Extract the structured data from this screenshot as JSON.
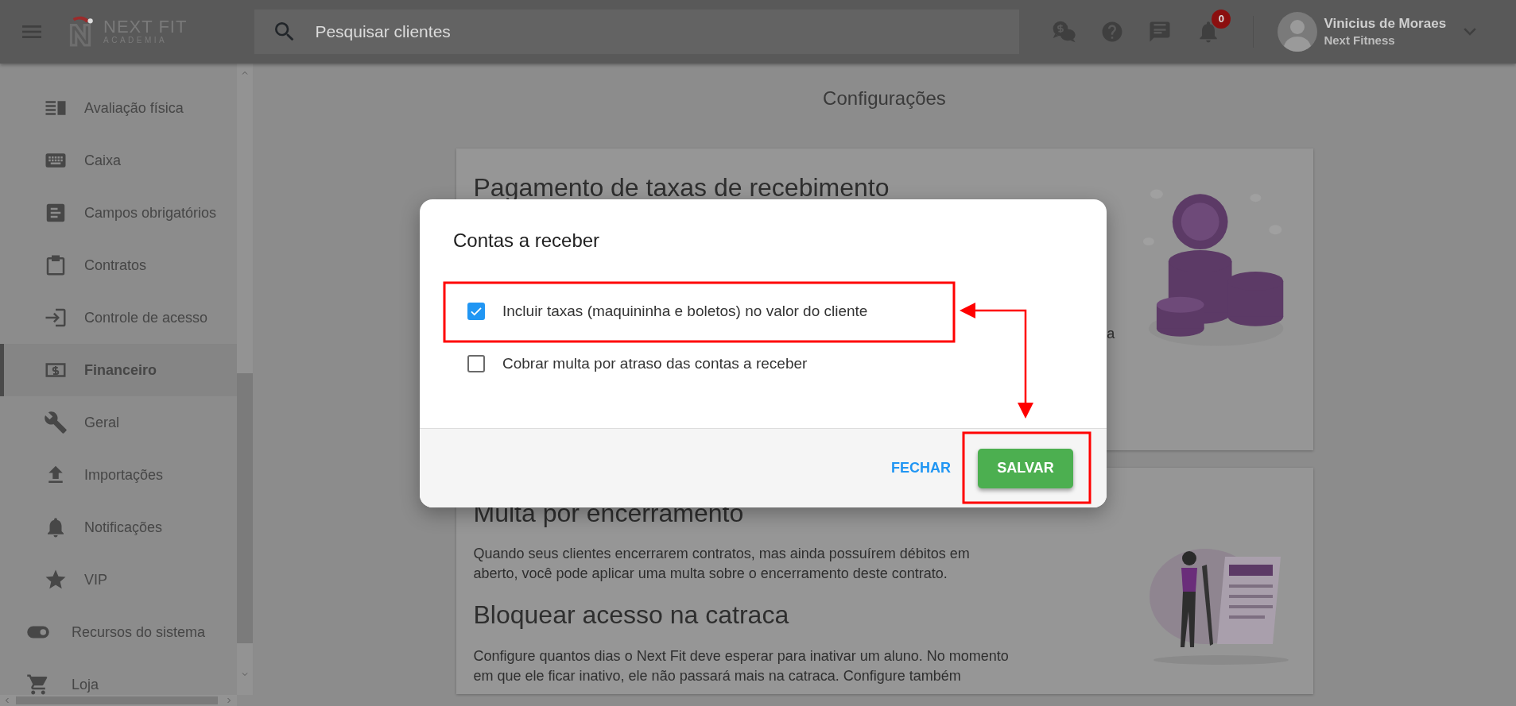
{
  "topbar": {
    "logo": {
      "title": "NEXT FIT",
      "subtitle": "ACADEMIA"
    },
    "search": {
      "placeholder": "Pesquisar clientes"
    },
    "notification_count": "0",
    "user": {
      "name": "Vinicius de Moraes",
      "company": "Next Fitness"
    }
  },
  "sidebar": {
    "items": [
      {
        "label": "Avaliação física",
        "kind": "subitem",
        "selected": false
      },
      {
        "label": "Caixa",
        "kind": "subitem",
        "selected": false
      },
      {
        "label": "Campos obrigatórios",
        "kind": "subitem",
        "selected": false
      },
      {
        "label": "Contratos",
        "kind": "subitem",
        "selected": false
      },
      {
        "label": "Controle de acesso",
        "kind": "subitem",
        "selected": false
      },
      {
        "label": "Financeiro",
        "kind": "subitem",
        "selected": true
      },
      {
        "label": "Geral",
        "kind": "subitem",
        "selected": false
      },
      {
        "label": "Importações",
        "kind": "subitem",
        "selected": false
      },
      {
        "label": "Notificações",
        "kind": "subitem",
        "selected": false
      },
      {
        "label": "VIP",
        "kind": "subitem",
        "selected": false
      },
      {
        "label": "Recursos do sistema",
        "kind": "item",
        "selected": false
      },
      {
        "label": "Loja",
        "kind": "item",
        "selected": false
      }
    ]
  },
  "page": {
    "title": "Configurações",
    "cards": [
      {
        "sections": [
          {
            "heading": "Pagamento de taxas de recebimento",
            "lines": [
              "a"
            ]
          }
        ]
      },
      {
        "sections": [
          {
            "heading": "Multa por encerramento",
            "lines": [
              "Quando seus clientes encerrarem contratos, mas ainda possuírem débitos em",
              "aberto, você pode aplicar uma multa sobre o encerramento deste contrato."
            ]
          },
          {
            "heading": "Bloquear acesso na catraca",
            "lines": [
              "Configure quantos dias o Next Fit deve esperar para inativar um aluno. No momento",
              "em que ele ficar inativo, ele não passará mais na catraca. Configure também"
            ]
          }
        ]
      }
    ]
  },
  "dialog": {
    "title": "Contas a receber",
    "options": [
      {
        "label": "Incluir taxas (maquininha e boletos) no valor do cliente",
        "checked": true
      },
      {
        "label": "Cobrar multa por atraso das contas a receber",
        "checked": false
      }
    ],
    "buttons": [
      {
        "label": "FECHAR",
        "kind": "text"
      },
      {
        "label": "SALVAR",
        "kind": "primary"
      }
    ]
  }
}
